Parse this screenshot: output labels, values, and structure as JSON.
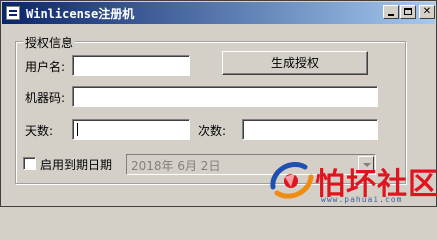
{
  "window": {
    "title": "Winlicense注册机",
    "minimize_label": "_",
    "maximize_label": "",
    "close_label": "✕",
    "app_icon": "app-icon"
  },
  "group": {
    "title": "授权信息"
  },
  "form": {
    "username_label": "用户名:",
    "username_value": "",
    "generate_button_label": "生成授权",
    "machine_code_label": "机器码:",
    "machine_code_value": "",
    "days_label": "天数:",
    "days_value": "",
    "count_label": "次数:",
    "count_value": "",
    "enable_expiry_label": "启用到期日期",
    "enable_expiry_checked": false,
    "expiry_date_value": "2018年 6月 2日"
  },
  "watermark": {
    "text": "怕坏社区",
    "url": "www.pahuai.com",
    "accent": "#e0141e"
  }
}
